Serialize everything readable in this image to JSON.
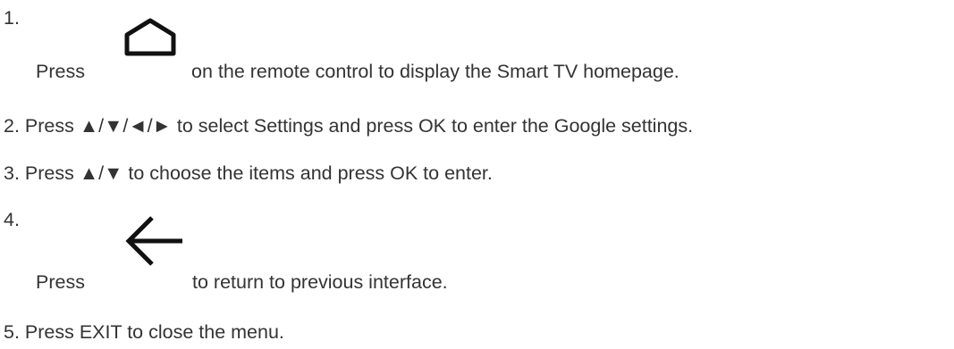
{
  "steps": [
    {
      "number": "1.",
      "before": "Press",
      "icon": "home-icon",
      "after": "on the remote control to display the Smart TV homepage."
    },
    {
      "text": "2. Press ▲/▼/◄/► to select Settings and press OK to enter the Google settings."
    },
    {
      "text": "3. Press ▲/▼ to choose the items and press OK to enter."
    },
    {
      "number": "4.",
      "before": "Press",
      "icon": "back-arrow-icon",
      "after": "to return to previous interface."
    },
    {
      "text": "5. Press EXIT to close the menu."
    }
  ]
}
